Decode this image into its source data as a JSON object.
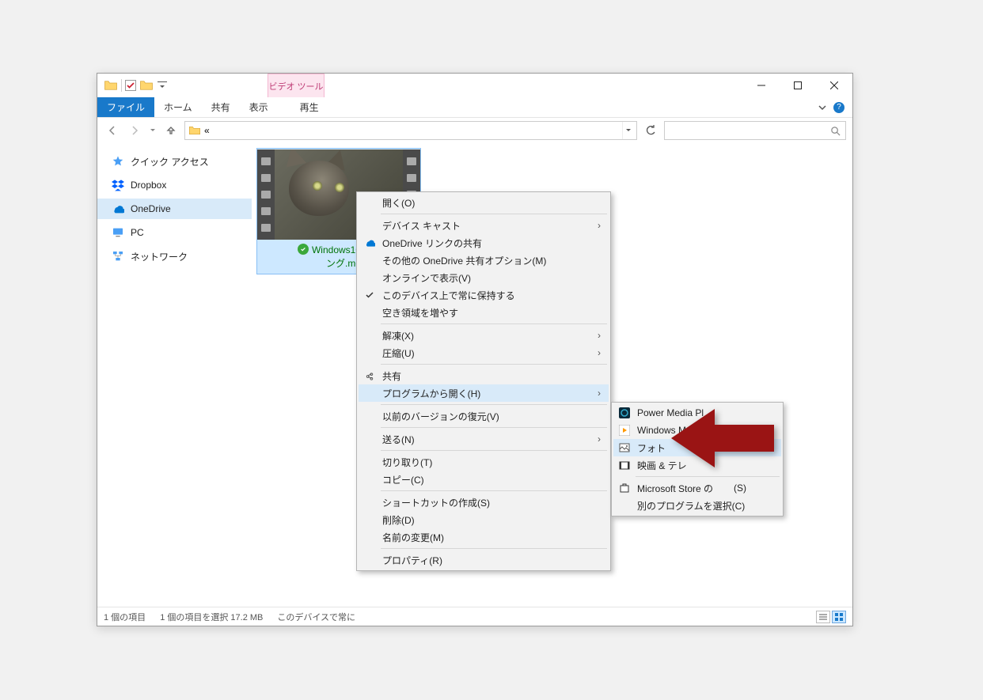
{
  "titlebar": {
    "video_tools": "ビデオ ツール"
  },
  "ribbon": {
    "file": "ファイル",
    "home": "ホーム",
    "share": "共有",
    "view": "表示",
    "play": "再生"
  },
  "address": {
    "path": "«"
  },
  "sidebar": {
    "quick_access": "クイック アクセス",
    "dropbox": "Dropbox",
    "onedrive": "OneDrive",
    "pc": "PC",
    "network": "ネットワーク"
  },
  "file": {
    "name_line1": "Windows10フォ",
    "name_line2": "ング.mov"
  },
  "status": {
    "items": "1 個の項目",
    "selected": "1 個の項目を選択 17.2 MB",
    "sync": "このデバイスで常に"
  },
  "context": {
    "open": "開く(O)",
    "cast": "デバイス キャスト",
    "onedrive_share": "OneDrive リンクの共有",
    "onedrive_other": "その他の OneDrive 共有オプション(M)",
    "view_online": "オンラインで表示(V)",
    "always_keep": "このデバイス上で常に保持する",
    "free_space": "空き領域を増やす",
    "extract": "解凍(X)",
    "compress": "圧縮(U)",
    "share": "共有",
    "open_with": "プログラムから開く(H)",
    "restore": "以前のバージョンの復元(V)",
    "send_to": "送る(N)",
    "cut": "切り取り(T)",
    "copy": "コピー(C)",
    "shortcut": "ショートカットの作成(S)",
    "delete": "削除(D)",
    "rename": "名前の変更(M)",
    "properties": "プロパティ(R)"
  },
  "submenu": {
    "power_media": "Power Media Pl",
    "windows_media": "Windows M",
    "photos": "フォト",
    "movies_tv": "映画 & テレ",
    "store": "Microsoft Store の",
    "store_suffix": "(S)",
    "choose": "別のプログラムを選択(C)"
  }
}
